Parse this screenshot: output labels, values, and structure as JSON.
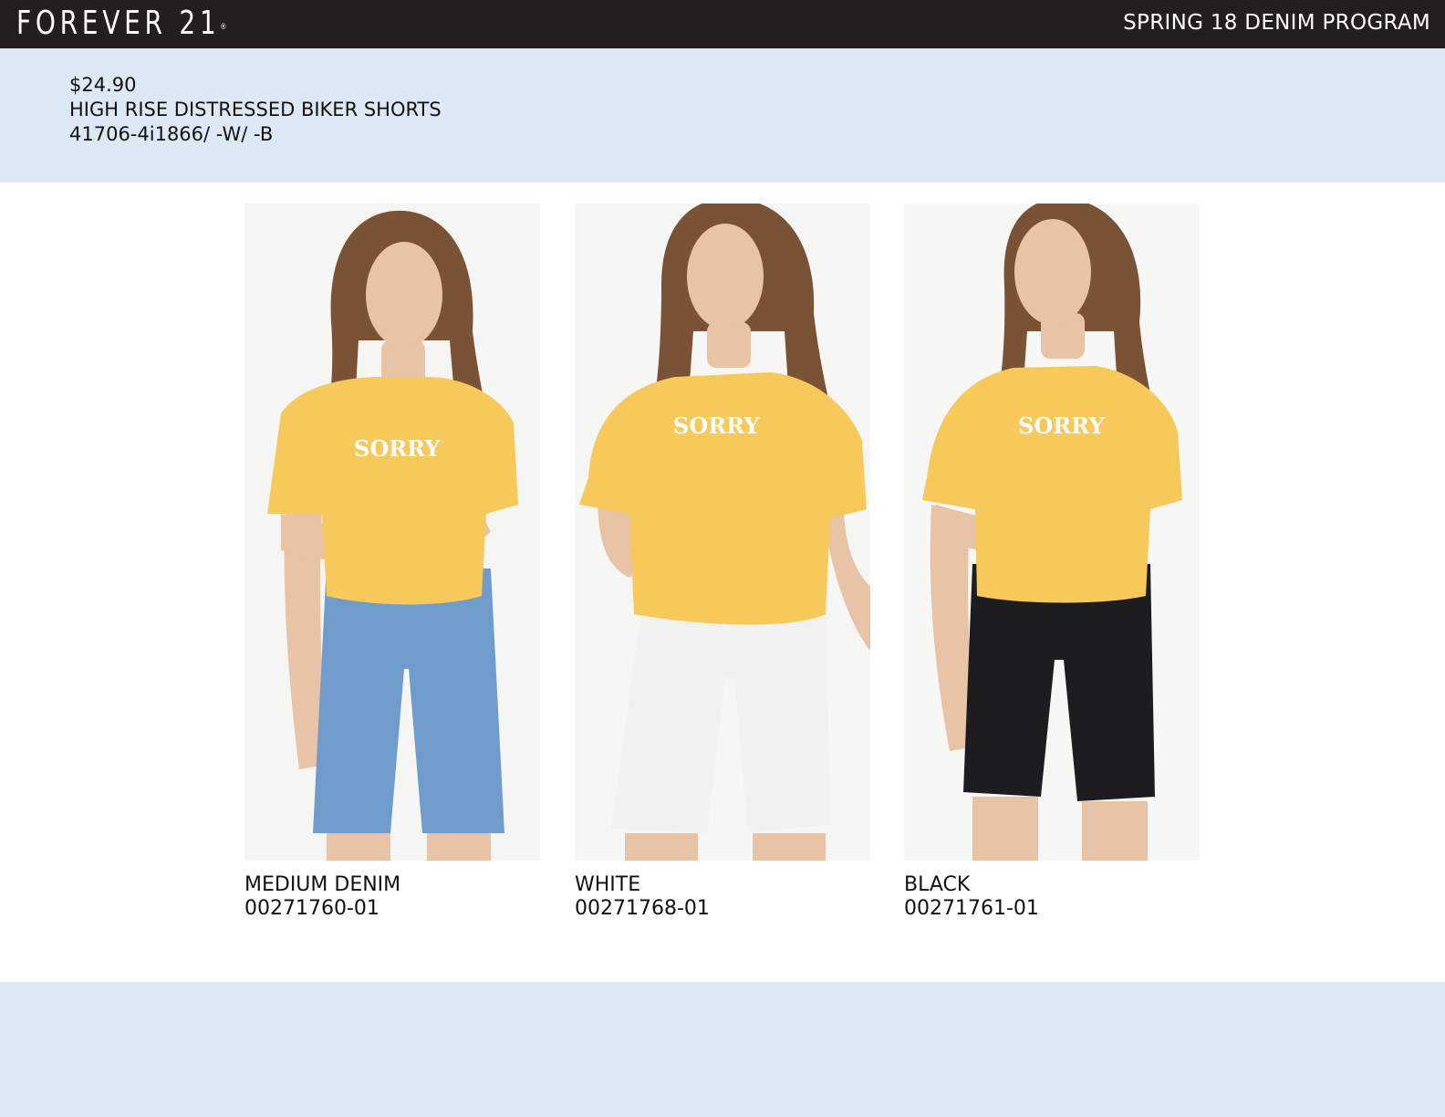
{
  "header": {
    "brand": "FOREVER 21",
    "brand_mark": "®",
    "program": "SPRING 18 DENIM PROGRAM"
  },
  "product_info": {
    "price": "$24.90",
    "name": "HIGH RISE DISTRESSED BIKER SHORTS",
    "style_number": "41706-4i1866/ -W/ -B"
  },
  "colorways": [
    {
      "color_name": "MEDIUM DENIM",
      "sku": "00271760-01",
      "shorts_color": "#6f9ccb",
      "tshirt_text": "SORRY"
    },
    {
      "color_name": "WHITE",
      "sku": "00271768-01",
      "shorts_color": "#f1f1ee",
      "tshirt_text": "SORRY"
    },
    {
      "color_name": "BLACK",
      "sku": "00271761-01",
      "shorts_color": "#1d1d1f",
      "tshirt_text": "SORRY"
    }
  ],
  "colors": {
    "header_bg": "#231f20",
    "band_bg": "#dde8f5",
    "tshirt": "#f6c95a",
    "hair": "#7a5236",
    "skin": "#e9c3a6"
  }
}
